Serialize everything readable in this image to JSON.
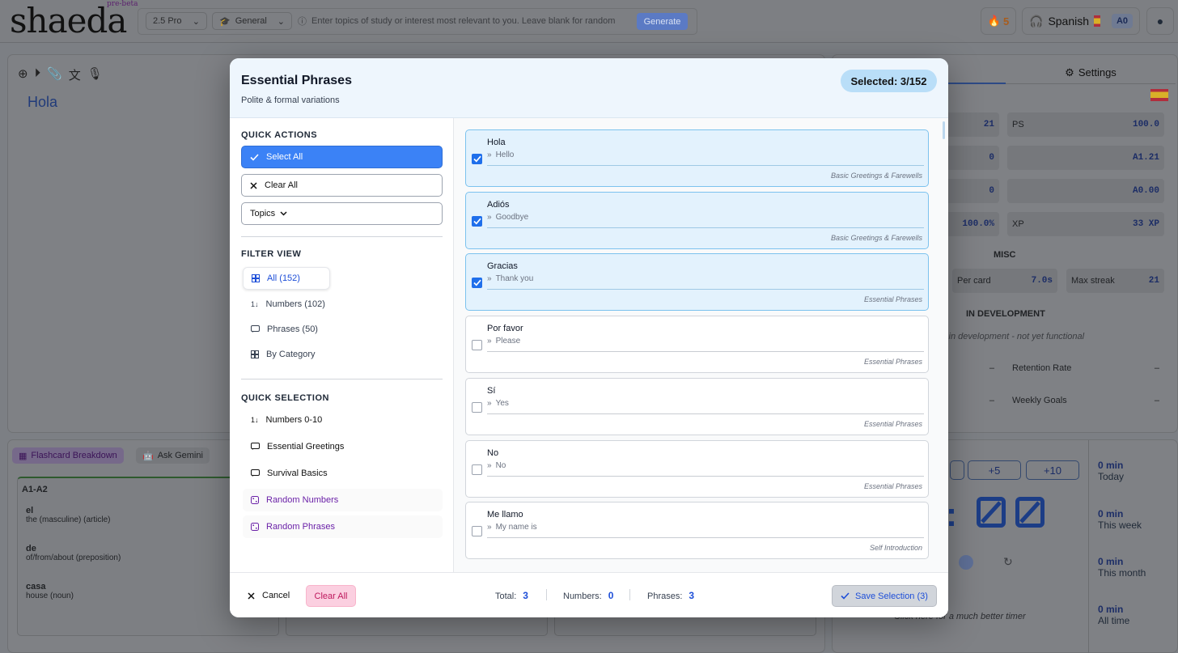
{
  "app": {
    "logo": "shaeda",
    "logo_badge": "pre-beta",
    "model": "2.5 Pro",
    "mode": "General",
    "topic_placeholder": "Enter topics of study or interest most relevant to you. Leave blank for random",
    "generate_label": "Generate",
    "streak": "5",
    "language": "Spanish",
    "level": "A0",
    "editor_text": "Hola",
    "settings_tab": "Settings",
    "stats": [
      {
        "label": "",
        "value": "21"
      },
      {
        "label": "PS",
        "value": "100.0"
      },
      {
        "label": "",
        "value": "0"
      },
      {
        "label": "",
        "value": "A1.21"
      },
      {
        "label": "",
        "value": "0"
      },
      {
        "label": "",
        "value": "A0.00"
      },
      {
        "label": "",
        "value": "100.0%"
      },
      {
        "label": "XP",
        "value": "33 XP"
      }
    ],
    "misc_heading": "MISC",
    "per_card_label": "Per card",
    "per_card_value": "7.0s",
    "max_streak_label": "Max streak",
    "max_streak_value": "21",
    "in_dev_heading": "IN DEVELOPMENT",
    "in_dev_note": "s in development - not yet functional",
    "retention_label": "Retention Rate",
    "weekly_goals_label": "Weekly Goals",
    "dash": "–",
    "flashcard_tab": "Flashcard Breakdown",
    "ask_tab": "Ask Gemini",
    "level_group": "A1-A2",
    "words": [
      {
        "word": "el",
        "def": "the (masculine) (article)"
      },
      {
        "word": "de",
        "def": "of/from/about (preposition)"
      },
      {
        "word": "casa",
        "def": "house (noun)"
      }
    ],
    "timer_buttons": [
      "+5",
      "+10"
    ],
    "timer_display": ":",
    "timer_link": "Click here for a much better timer",
    "time_stats": [
      {
        "value": "0 min",
        "label": "Today"
      },
      {
        "value": "0 min",
        "label": "This week"
      },
      {
        "value": "0 min",
        "label": "This month"
      },
      {
        "value": "0 min",
        "label": "All time"
      }
    ]
  },
  "modal": {
    "title": "Essential Phrases",
    "subtitle": "Polite & formal variations",
    "selected_badge": "Selected: 3/152",
    "quick_actions_heading": "QUICK ACTIONS",
    "select_all": "Select All",
    "clear_all": "Clear All",
    "topics": "Topics",
    "filter_heading": "FILTER VIEW",
    "filters": [
      "All (152)",
      "Numbers (102)",
      "Phrases (50)",
      "By Category"
    ],
    "quick_selection_heading": "QUICK SELECTION",
    "quick_selection": [
      "Numbers 0-10",
      "Essential Greetings",
      "Survival Basics",
      "Random Numbers",
      "Random Phrases"
    ],
    "items": [
      {
        "phrase": "Hola",
        "translation": "Hello",
        "category": "Basic Greetings & Farewells",
        "checked": true
      },
      {
        "phrase": "Adiós",
        "translation": "Goodbye",
        "category": "Basic Greetings & Farewells",
        "checked": true
      },
      {
        "phrase": "Gracias",
        "translation": "Thank you",
        "category": "Essential Phrases",
        "checked": true
      },
      {
        "phrase": "Por favor",
        "translation": "Please",
        "category": "Essential Phrases",
        "checked": false
      },
      {
        "phrase": "Sí",
        "translation": "Yes",
        "category": "Essential Phrases",
        "checked": false
      },
      {
        "phrase": "No",
        "translation": "No",
        "category": "Essential Phrases",
        "checked": false
      },
      {
        "phrase": "Me llamo",
        "translation": "My name is",
        "category": "Self Introduction",
        "checked": false
      }
    ],
    "footer": {
      "cancel": "Cancel",
      "clear_all": "Clear All",
      "total_label": "Total:",
      "total_value": "3",
      "numbers_label": "Numbers:",
      "numbers_value": "0",
      "phrases_label": "Phrases:",
      "phrases_value": "3",
      "save": "Save Selection (3)"
    }
  },
  "colors": {
    "accent": "#3b82f6",
    "selected_bg": "#e3f2fd",
    "purple": "#6b21a8",
    "pink": "#fbcfe0"
  }
}
